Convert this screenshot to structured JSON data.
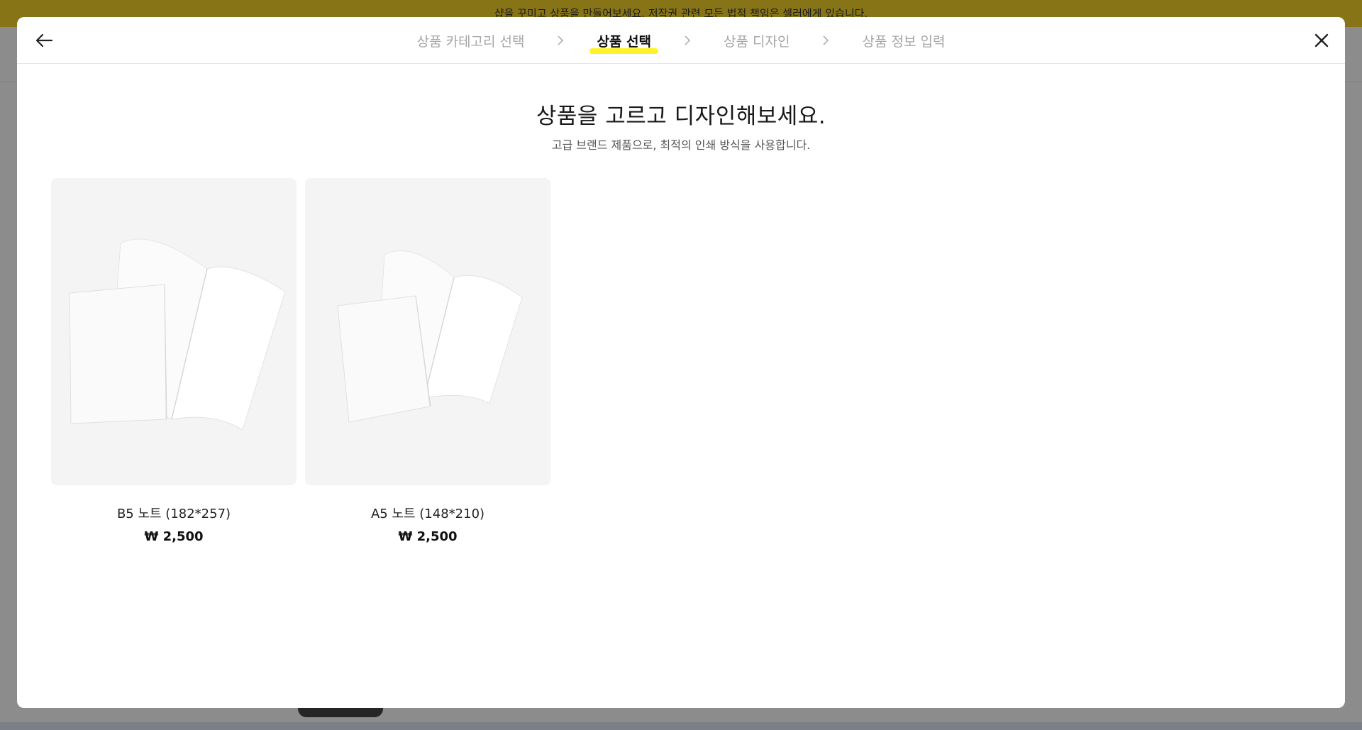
{
  "background": {
    "banner_text": "샵을 꾸미고 상품을 만들어보세요. 저작권 관련 모든 법적 책임은 셀러에게 있습니다."
  },
  "modal": {
    "steps": [
      {
        "label": "상품 카테고리 선택",
        "active": false
      },
      {
        "label": "상품 선택",
        "active": true
      },
      {
        "label": "상품 디자인",
        "active": false
      },
      {
        "label": "상품 정보 입력",
        "active": false
      }
    ],
    "title": "상품을 고르고 디자인해보세요.",
    "subtitle": "고급 브랜드 제품으로, 최적의 인쇄 방식을 사용합니다.",
    "products": [
      {
        "name": "B5 노트 (182*257)",
        "price": "₩ 2,500",
        "icon": "notebook-image"
      },
      {
        "name": "A5 노트 (148*210)",
        "price": "₩ 2,500",
        "icon": "notebook-image"
      }
    ]
  },
  "colors": {
    "banner": "#f5d42a",
    "highlight": "#fff22a",
    "inactive_step": "#a7a7a7"
  }
}
